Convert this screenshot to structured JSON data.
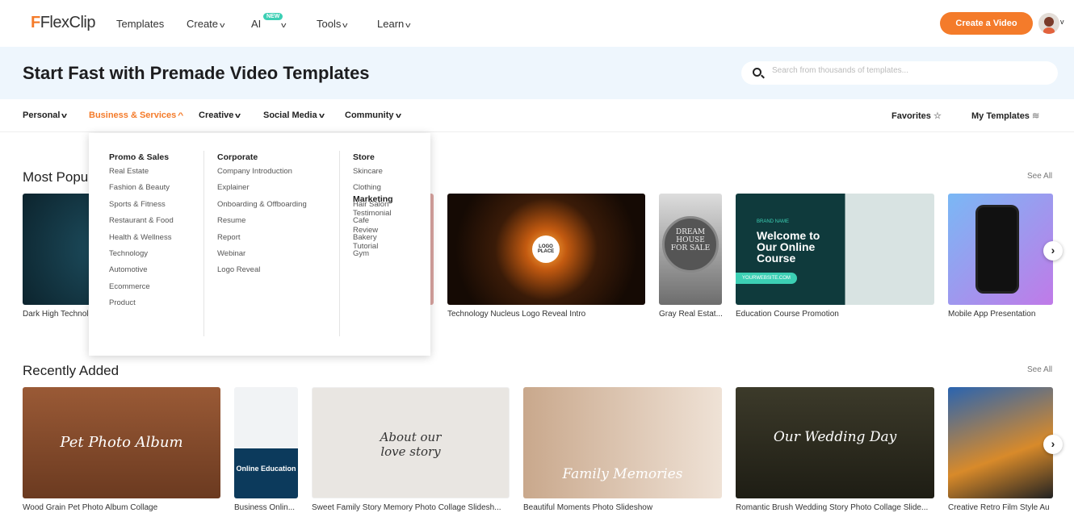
{
  "nav": {
    "logo": "FlexClip",
    "items": [
      "Templates",
      "Create",
      "AI",
      "Tools",
      "Learn"
    ],
    "new_badge": "NEW",
    "cta": "Create a Video"
  },
  "hero": {
    "title": "Start Fast with Premade Video Templates",
    "search_placeholder": "Search from thousands of templates..."
  },
  "categories": [
    "Personal",
    "Business & Services",
    "Creative",
    "Social Media",
    "Community"
  ],
  "right_links": {
    "favorites": "Favorites",
    "my_templates": "My Templates"
  },
  "dropdown": {
    "promo": {
      "title": "Promo & Sales",
      "items": [
        "Real Estate",
        "Fashion & Beauty",
        "Sports & Fitness",
        "Restaurant & Food",
        "Health & Wellness",
        "Technology",
        "Automotive",
        "Ecommerce",
        "Product"
      ]
    },
    "corporate": {
      "title": "Corporate",
      "items": [
        "Company Introduction",
        "Explainer",
        "Onboarding & Offboarding",
        "Resume",
        "Report",
        "Webinar",
        "Logo Reveal"
      ]
    },
    "store": {
      "title": "Store",
      "items": [
        "Skincare",
        "Clothing",
        "Hair Salon",
        "Cafe",
        "Bakery",
        "Gym"
      ]
    },
    "marketing": {
      "title": "Marketing",
      "items": [
        "Testimonial",
        "Review",
        "Tutorial"
      ]
    }
  },
  "popular": {
    "title": "Most Popular",
    "see_all": "See All",
    "cards": [
      "Dark High Technology Logo Reveal",
      "",
      "Technology Nucleus Logo Reveal Intro",
      "Gray Real Estat...",
      "Education Course Promotion",
      "Mobile App Presentation"
    ],
    "thumb_text": {
      "logo": "LOGO PLACE",
      "house": "DREAM HOUSE FOR SALE",
      "edu_title": "Welcome to Our Online Course",
      "edu_brand": "BRAND NAME",
      "edu_site": "YOURWEBSITE.COM"
    }
  },
  "recent": {
    "title": "Recently Added",
    "see_all": "See All",
    "cards": [
      "Wood Grain Pet Photo Album Collage",
      "Business Onlin...",
      "Sweet Family Story Memory Photo Collage Slidesh...",
      "Beautiful Moments Photo Slideshow",
      "Romantic Brush Wedding Story Photo Collage Slide...",
      "Creative Retro Film Style Au"
    ],
    "thumb_text": {
      "pet": "Pet Photo Album",
      "edu": "Online Education",
      "love": "About our love story",
      "family": "Family Memories",
      "wedding": "Our Wedding Day"
    }
  },
  "colors": {
    "accent": "#f47b2a",
    "hero_bg": "#eef6fd",
    "badge": "#3ccfb4"
  }
}
